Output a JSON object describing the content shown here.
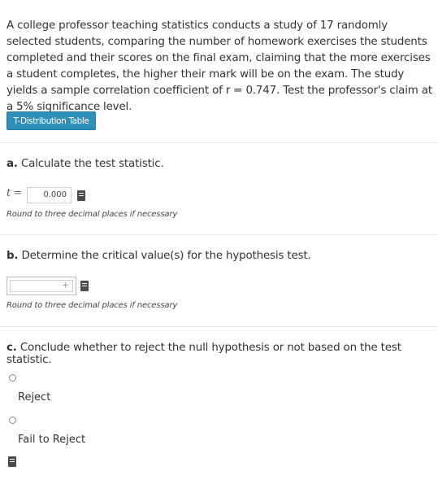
{
  "problem": {
    "text": "A college professor teaching statistics conducts a study of 17 randomly selected students, comparing the number of homework exercises the students completed and their scores on the final exam, claiming that the more exercises a student completes, the higher their mark will be on the exam. The study yields a sample correlation coefficient of r = 0.747. Test the professor's claim at a 5% significance level."
  },
  "table_button": {
    "label": "T-Distribution Table"
  },
  "part_a": {
    "letter": "a.",
    "question": "Calculate the test statistic.",
    "var_label": "t",
    "equals": "=",
    "value": "0.000",
    "hint": "Round to three decimal places if necessary"
  },
  "part_b": {
    "letter": "b.",
    "question": "Determine the critical value(s) for the hypothesis test.",
    "add_symbol": "+",
    "hint": "Round to three decimal places if necessary"
  },
  "part_c": {
    "letter": "c.",
    "question": "Conclude whether to reject the null hypothesis or not based on the test statistic.",
    "options": [
      "Reject",
      "Fail to Reject"
    ]
  }
}
